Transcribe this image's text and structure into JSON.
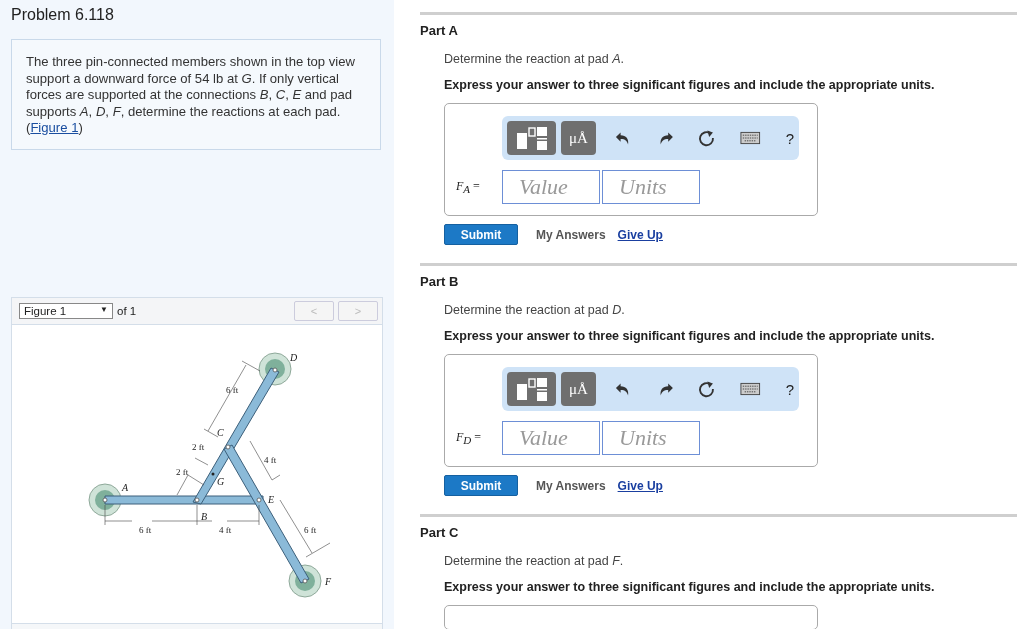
{
  "problem": {
    "title": "Problem 6.118",
    "text": "The three pin-connected members shown in the top view support a downward force of 54 lb at *G*. If only vertical forces are supported at the connections *B*, *C*, *E* and pad supports *A*, *D*, *F*, determine the reactions at each pad. (",
    "figure_link": "Figure 1",
    "link_close": ")"
  },
  "figure": {
    "select": "Figure 1",
    "select_caret": "▼",
    "of": "of 1",
    "prev": "<",
    "next": ">",
    "prev_disabled": true,
    "next_disabled": true,
    "labels": [
      {
        "text": "D",
        "kind": "point"
      },
      {
        "text": "6 ft",
        "kind": "dimension"
      },
      {
        "text": "C",
        "kind": "point"
      },
      {
        "text": "2 ft",
        "kind": "dimension"
      },
      {
        "text": "4 ft",
        "kind": "dimension"
      },
      {
        "text": "2 ft",
        "kind": "dimension"
      },
      {
        "text": "G",
        "kind": "point"
      },
      {
        "text": "A",
        "kind": "point"
      },
      {
        "text": "E",
        "kind": "point"
      },
      {
        "text": "B",
        "kind": "point"
      },
      {
        "text": "6 ft",
        "kind": "dimension"
      },
      {
        "text": "4 ft",
        "kind": "dimension"
      },
      {
        "text": "6 ft",
        "kind": "dimension"
      },
      {
        "text": "F",
        "kind": "point"
      }
    ]
  },
  "parts": [
    {
      "title": "Part A",
      "question": "Determine the reaction at pad *A*.",
      "instruction": "Express your answer to three significant figures and include the appropriate units.",
      "units_button": "μÅ",
      "help": "?",
      "label": "*F*$_{A}$ =",
      "value_placeholder": "Value",
      "units_placeholder": "Units",
      "submit": "Submit",
      "my_answers": "My Answers",
      "give_up": "Give Up",
      "show_answer": true
    },
    {
      "title": "Part B",
      "question": "Determine the reaction at pad *D*.",
      "instruction": "Express your answer to three significant figures and include the appropriate units.",
      "units_button": "μÅ",
      "help": "?",
      "label": "*F*$_{D}$ =",
      "value_placeholder": "Value",
      "units_placeholder": "Units",
      "submit": "Submit",
      "my_answers": "My Answers",
      "give_up": "Give Up",
      "show_answer": true
    },
    {
      "title": "Part C",
      "question": "Determine the reaction at pad *F*.",
      "instruction": "Express your answer to three significant figures and include the appropriate units.",
      "show_answer": false
    }
  ]
}
